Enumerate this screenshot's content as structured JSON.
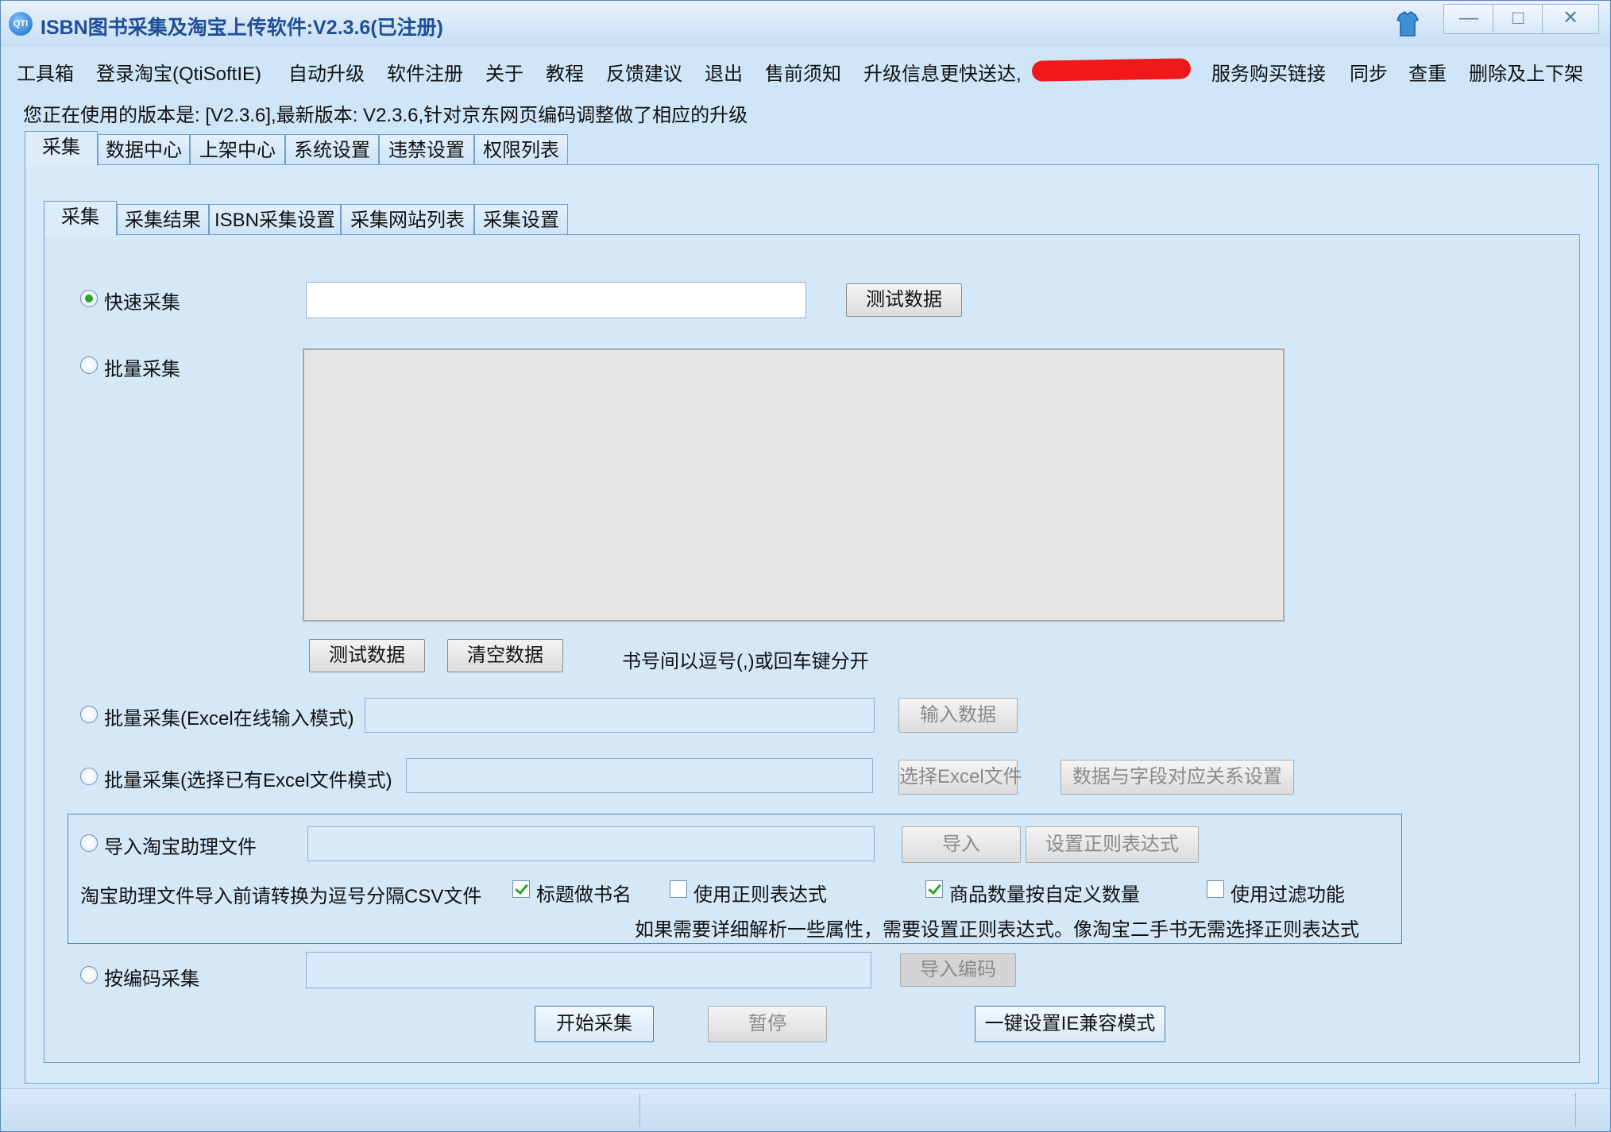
{
  "window": {
    "title": "ISBN图书采集及淘宝上传软件:V2.3.6(已注册)",
    "app_icon": "app-logo-icon",
    "controls": {
      "minimize": "—",
      "maximize": "□",
      "close": "✕"
    }
  },
  "menu": [
    "工具箱",
    "登录淘宝(QtiSoftIE)",
    "自动升级",
    "软件注册",
    "关于",
    "教程",
    "反馈建议",
    "退出",
    "售前须知",
    "升级信息更快送达,",
    "服务购买链接",
    "同步",
    "查重",
    "删除及上下架"
  ],
  "version_line": "您正在使用的版本是: [V2.3.6],最新版本: V2.3.6,针对京东网页编码调整做了相应的升级",
  "main_tabs": [
    "采集",
    "数据中心",
    "上架中心",
    "系统设置",
    "违禁设置",
    "权限列表"
  ],
  "sub_tabs": [
    "采集",
    "采集结果",
    "ISBN采集设置",
    "采集网站列表",
    "采集设置"
  ],
  "quick": {
    "label": "快速采集",
    "value": "",
    "button": "测试数据",
    "selected": true
  },
  "batch": {
    "label": "批量采集",
    "text": "",
    "test_button": "测试数据",
    "clear_button": "清空数据",
    "hint": "书号间以逗号(,)或回车键分开"
  },
  "batch_excel_online": {
    "label": "批量采集(Excel在线输入模式)",
    "value": "",
    "button": "输入数据"
  },
  "batch_excel_file": {
    "label": "批量采集(选择已有Excel文件模式)",
    "value": "",
    "button": "选择Excel文件",
    "mapping_button": "数据与字段对应关系设置"
  },
  "taobao_import": {
    "label": "导入淘宝助理文件",
    "value": "",
    "import_button": "导入",
    "regex_button": "设置正则表达式",
    "note": "淘宝助理文件导入前请转换为逗号分隔CSV文件",
    "options": [
      {
        "label": "标题做书名",
        "checked": true
      },
      {
        "label": "使用正则表达式",
        "checked": false
      },
      {
        "label": "商品数量按自定义数量",
        "checked": true
      },
      {
        "label": "使用过滤功能",
        "checked": false
      }
    ],
    "hint": "如果需要详细解析一些属性，需要设置正则表达式。像淘宝二手书无需选择正则表达式"
  },
  "code_collect": {
    "label": "按编码采集",
    "value": "",
    "button": "导入编码"
  },
  "actions": {
    "start": "开始采集",
    "pause": "暂停",
    "ie_compat": "一键设置IE兼容模式"
  }
}
